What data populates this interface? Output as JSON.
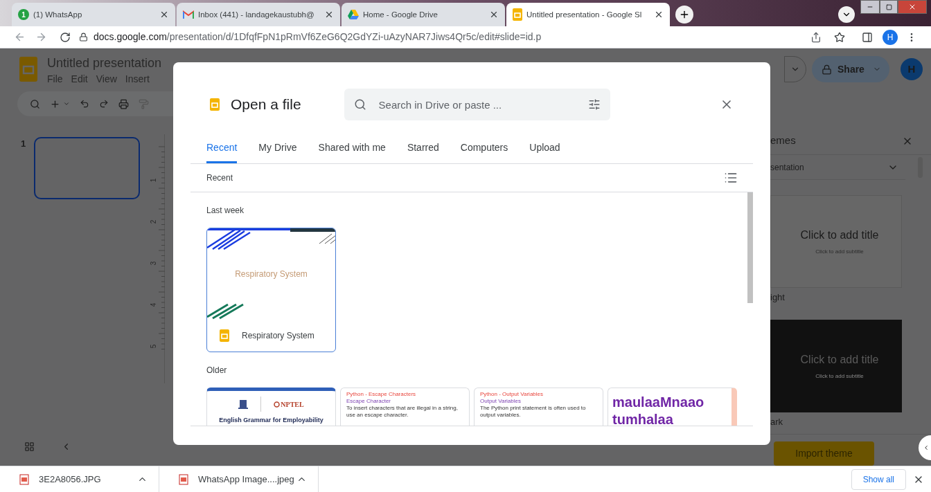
{
  "browser": {
    "tabs": [
      {
        "kind": "whatsapp",
        "badge": "1",
        "title": "(1) WhatsApp",
        "selected": false
      },
      {
        "kind": "gmail",
        "title": "Inbox (441) - landagekaustubh@",
        "selected": false
      },
      {
        "kind": "drive",
        "title": "Home - Google Drive",
        "selected": false
      },
      {
        "kind": "slides",
        "title": "Untitled presentation - Google Sl",
        "selected": true
      }
    ],
    "url_host": "docs.google.com",
    "url_path": "/presentation/d/1DfqfFpN1pRmVf6ZeG6Q2GdYZi-uAzyNAR7Jiws4Qr5c/edit#slide=id.p",
    "profile": "H"
  },
  "app": {
    "title": "Untitled presentation",
    "menu": [
      "File",
      "Edit",
      "View",
      "Insert"
    ],
    "share": "Share",
    "avatar": "H",
    "slides": [
      {
        "number": "1",
        "selected": true
      }
    ],
    "ruler": [
      "1",
      "2",
      "3",
      "4",
      "5"
    ],
    "themes": {
      "title": "emes",
      "dropdown": "sentation",
      "items": [
        {
          "kind": "light",
          "title": "Click to add title",
          "subtitle": "Click to add subtitle",
          "label": "ight"
        },
        {
          "kind": "dark",
          "title": "Click to add title",
          "subtitle": "Click to add subtitle",
          "label": "ark"
        }
      ],
      "import": "Import theme"
    }
  },
  "dialog": {
    "title": "Open a file",
    "search": {
      "placeholder": "Search in Drive or paste ..."
    },
    "tabs": [
      {
        "label": "Recent",
        "selected": true
      },
      {
        "label": "My Drive",
        "selected": false
      },
      {
        "label": "Shared with me",
        "selected": false
      },
      {
        "label": "Starred",
        "selected": false
      },
      {
        "label": "Computers",
        "selected": false
      },
      {
        "label": "Upload",
        "selected": false
      }
    ],
    "subheader": "Recent",
    "groups": [
      {
        "heading": "Last week",
        "files": [
          {
            "kind": "deck",
            "thumb_title": "Respiratory System",
            "name": "Respiratory System",
            "selected": true
          }
        ]
      },
      {
        "heading": "Older",
        "files": [
          {
            "kind": "logo_title",
            "logo": "NPTEL",
            "title": "English Grammar for Employability",
            "selected": false
          },
          {
            "kind": "notes",
            "heading": "Python - Escape Characters",
            "subheading": "Escape Character",
            "lines": [
              "To insert characters that are illegal in a string, use an escape character."
            ],
            "selected": false
          },
          {
            "kind": "notes",
            "heading": "Python - Output Variables",
            "subheading": "Output Variables",
            "lines": [
              "The Python print statement is often used to output variables."
            ],
            "selected": false
          },
          {
            "kind": "big_text",
            "lines": [
              "maulaaMnaao",
              "tumhalaa"
            ],
            "selected": false
          }
        ]
      }
    ]
  },
  "downloads": {
    "items": [
      "3E2A8056.JPG",
      "WhatsApp Image....jpeg"
    ],
    "show_all": "Show all"
  }
}
